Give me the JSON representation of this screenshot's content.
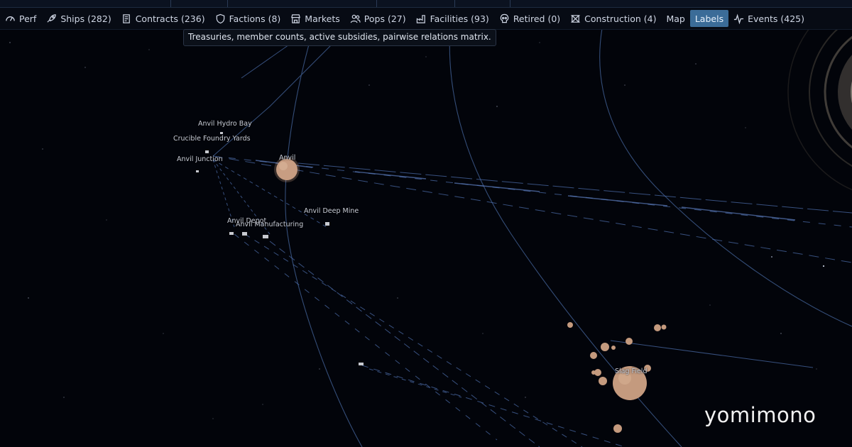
{
  "toolbar": {
    "perf": "Perf",
    "ships": "Ships (282)",
    "contracts": "Contracts (236)",
    "factions": "Factions (8)",
    "markets": "Markets",
    "pops": "Pops (27)",
    "facilities": "Facilities (93)",
    "retired": "Retired (0)",
    "construction": "Construction (4)",
    "map": "Map",
    "labels": "Labels",
    "events": "Events (425)"
  },
  "tooltip": "Treasuries, member counts, active subsidies, pairwise relations matrix.",
  "map_labels": {
    "anvil_hydro_bay": "Anvil Hydro Bay",
    "crucible_foundry_yards": "Crucible Foundry Yards",
    "anvil_junction": "Anvil Junction",
    "anvil": "Anvil",
    "anvil_deep_mine": "Anvil Deep Mine",
    "anvil_depot": "Anvil Depot",
    "anvil_manufacturing": "Anvil Manufacturing",
    "slag_field": "Slag Field"
  },
  "icons": [
    "gauge-icon",
    "rocket-icon",
    "scroll-icon",
    "shield-icon",
    "store-icon",
    "users-icon",
    "factory-icon",
    "skull-icon",
    "crane-icon",
    "pulse-icon"
  ],
  "colors": {
    "active_tab": "#3b6c98",
    "orbit": "#3d5a8c",
    "asteroid": "#c49a7e",
    "background": "#02040a"
  },
  "watermark": "yomimono"
}
